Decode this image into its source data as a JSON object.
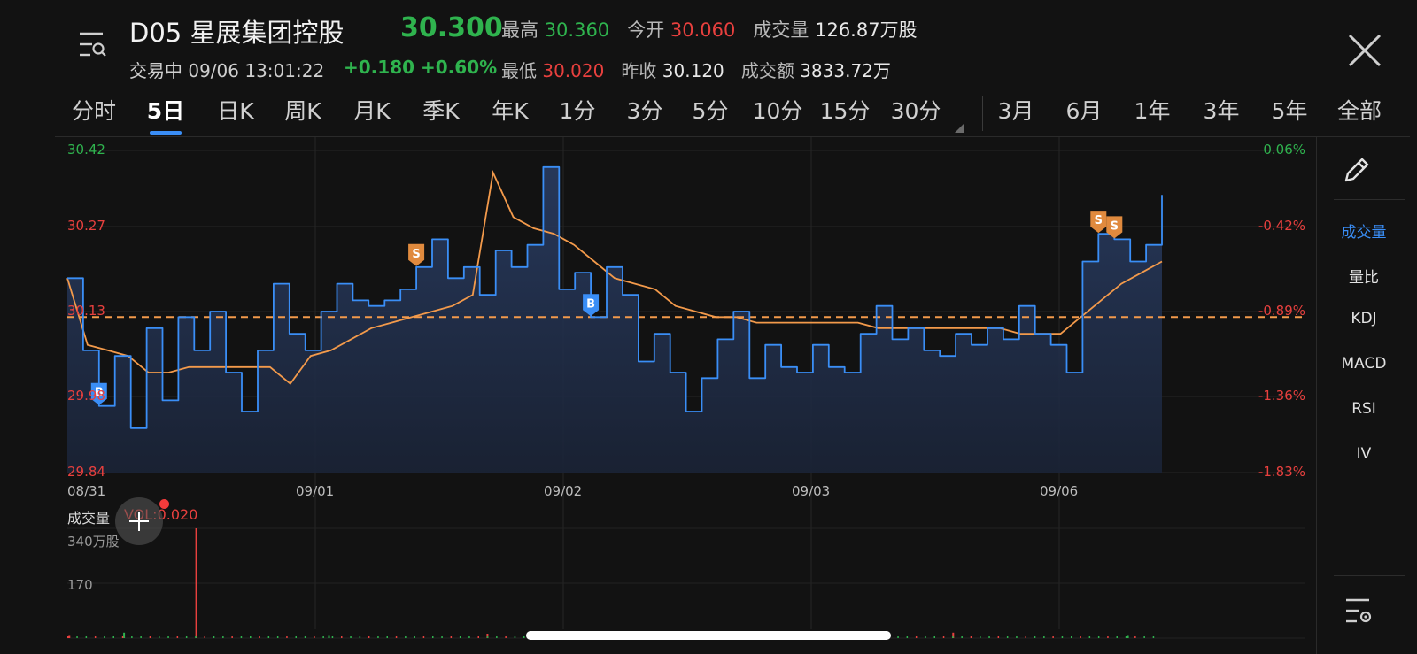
{
  "header": {
    "stock_name": "D05 星展集团控股",
    "price": "30.300",
    "status": "交易中 09/06 13:01:22",
    "change": "+0.180",
    "change_pct": "+0.60%",
    "high_label": "最高",
    "high": "30.360",
    "open_label": "今开",
    "open": "30.060",
    "volume_label": "成交量",
    "volume": "126.87万股",
    "low_label": "最低",
    "low": "30.020",
    "prev_close_label": "昨收",
    "prev_close": "30.120",
    "turnover_label": "成交额",
    "turnover": "3833.72万"
  },
  "tabs": [
    "分时",
    "5日",
    "日K",
    "周K",
    "月K",
    "季K",
    "年K",
    "1分",
    "3分",
    "5分",
    "10分",
    "15分",
    "30分",
    "3月",
    "6月",
    "1年",
    "3年",
    "5年",
    "全部"
  ],
  "active_tab": "5日",
  "y_left": [
    "30.42",
    "30.27",
    "30.13",
    "29.98",
    "29.84"
  ],
  "y_right": [
    "0.06%",
    "-0.42%",
    "-0.89%",
    "-1.36%",
    "-1.83%"
  ],
  "x_labels": [
    "08/31",
    "09/01",
    "09/02",
    "09/03",
    "09/06"
  ],
  "volume_panel": {
    "title": "成交量",
    "vol_label": "VOL:0.020",
    "max_label": "340万股",
    "mid_label": "170"
  },
  "indicators": [
    "成交量",
    "量比",
    "KDJ",
    "MACD",
    "RSI",
    "IV"
  ],
  "active_indicator": "成交量",
  "markers": [
    "B",
    "S",
    "B",
    "S",
    "S"
  ],
  "colors": {
    "up": "#2fb34e",
    "down": "#e8403e",
    "price_line": "#3a8ef6",
    "avg_line": "#f39a4b",
    "accent": "#3a8ef6",
    "background": "#121212"
  },
  "chart_data": {
    "type": "line",
    "ylim": [
      29.84,
      30.42
    ],
    "prev_close": 30.12,
    "x": [
      "08/31",
      "09/01",
      "09/02",
      "09/03",
      "09/06"
    ],
    "series": [
      {
        "values": [
          30.19,
          30.06,
          29.96,
          30.05,
          29.92,
          30.1,
          29.97,
          30.12,
          30.06,
          30.13,
          30.02,
          29.95,
          30.06,
          30.18,
          30.09,
          30.06,
          30.13,
          30.18,
          30.15,
          30.14,
          30.15,
          30.17,
          30.21,
          30.26,
          30.19,
          30.21,
          30.16,
          30.24,
          30.21,
          30.25,
          30.39,
          30.17,
          30.2,
          30.12,
          30.21,
          30.16,
          30.04,
          30.09,
          30.02,
          29.95,
          30.01,
          30.08,
          30.13,
          30.01,
          30.07,
          30.03,
          30.02,
          30.07,
          30.03,
          30.02,
          30.09,
          30.14,
          30.08,
          30.1,
          30.06,
          30.05,
          30.09,
          30.07,
          30.1,
          30.08,
          30.14,
          30.09,
          30.07,
          30.02,
          30.22,
          30.27,
          30.26,
          30.22,
          30.25,
          30.34
        ]
      },
      {
        "values": [
          30.19,
          30.07,
          30.06,
          30.05,
          30.02,
          30.02,
          30.03,
          30.03,
          30.03,
          30.03,
          30.03,
          30.0,
          30.05,
          30.06,
          30.08,
          30.1,
          30.11,
          30.12,
          30.13,
          30.14,
          30.16,
          30.38,
          30.3,
          30.28,
          30.27,
          30.25,
          30.22,
          30.19,
          30.18,
          30.17,
          30.14,
          30.13,
          30.12,
          30.12,
          30.11,
          30.11,
          30.11,
          30.11,
          30.11,
          30.11,
          30.1,
          30.1,
          30.1,
          30.1,
          30.1,
          30.1,
          30.1,
          30.09,
          30.09,
          30.09,
          30.12,
          30.15,
          30.18,
          30.2,
          30.22
        ]
      }
    ],
    "volume_ylim": [
      0,
      340
    ],
    "grid": true
  }
}
